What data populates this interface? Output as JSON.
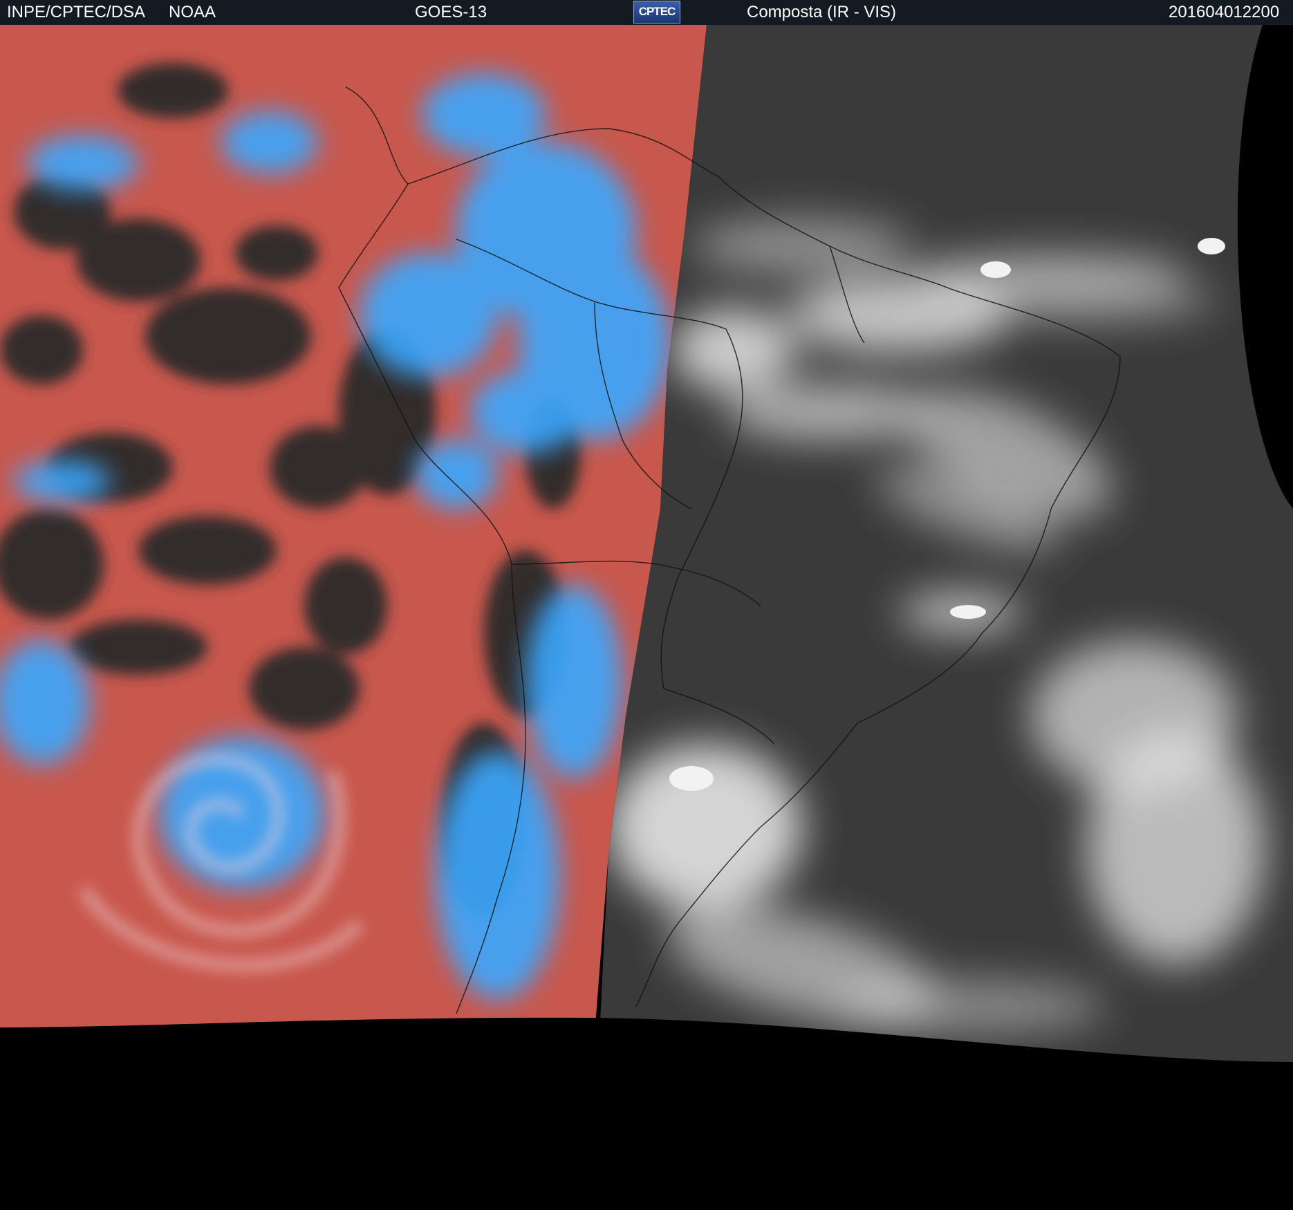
{
  "header": {
    "agency": "INPE/CPTEC/DSA",
    "partner": "NOAA",
    "satellite": "GOES-13",
    "logo_text": "CPTEC",
    "product": "Composta (IR - VIS)",
    "timestamp": "201604012200"
  },
  "colors": {
    "header_bg": "#141a22",
    "ir_red": "#c8584e",
    "ir_cold_cloud": "#3aa8ff",
    "ir_clear": "#2a2a2a",
    "vis_background": "#3a3a3a",
    "vis_cloud": "#e6e6e6",
    "outside_disk": "#000000"
  },
  "map": {
    "description_panels": [
      "infrared-composite-west",
      "visible-east"
    ],
    "region": "South America"
  }
}
